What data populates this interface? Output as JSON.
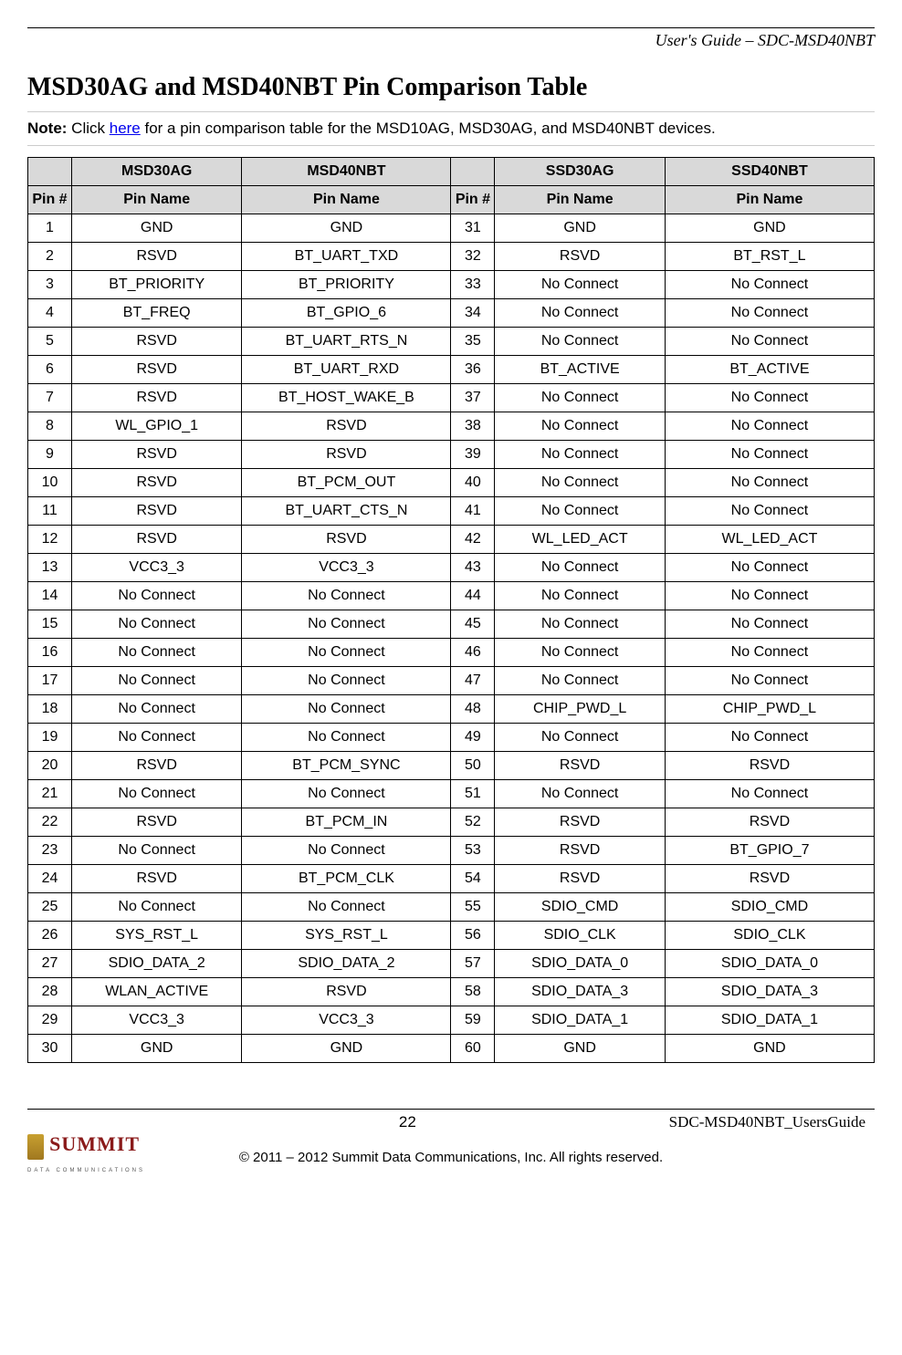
{
  "header": {
    "doc_title": "User's Guide – SDC-MSD40NBT"
  },
  "title": "MSD30AG and MSD40NBT Pin Comparison Table",
  "note": {
    "prefix": "Note:",
    "before_link": " Click ",
    "link_text": "here",
    "after_link": " for a pin comparison table for the MSD10AG, MSD30AG, and MSD40NBT devices."
  },
  "table": {
    "top_headers": [
      "",
      "MSD30AG",
      "MSD40NBT",
      "",
      "SSD30AG",
      "SSD40NBT"
    ],
    "sub_headers": [
      "Pin #",
      "Pin Name",
      "Pin Name",
      "Pin #",
      "Pin Name",
      "Pin Name"
    ],
    "rows": [
      [
        "1",
        "GND",
        "GND",
        "31",
        "GND",
        "GND"
      ],
      [
        "2",
        "RSVD",
        "BT_UART_TXD",
        "32",
        "RSVD",
        "BT_RST_L"
      ],
      [
        "3",
        "BT_PRIORITY",
        "BT_PRIORITY",
        "33",
        "No Connect",
        "No Connect"
      ],
      [
        "4",
        "BT_FREQ",
        "BT_GPIO_6",
        "34",
        "No Connect",
        "No Connect"
      ],
      [
        "5",
        "RSVD",
        "BT_UART_RTS_N",
        "35",
        "No Connect",
        "No Connect"
      ],
      [
        "6",
        "RSVD",
        "BT_UART_RXD",
        "36",
        "BT_ACTIVE",
        "BT_ACTIVE"
      ],
      [
        "7",
        "RSVD",
        "BT_HOST_WAKE_B",
        "37",
        "No Connect",
        "No Connect"
      ],
      [
        "8",
        "WL_GPIO_1",
        "RSVD",
        "38",
        "No Connect",
        "No Connect"
      ],
      [
        "9",
        "RSVD",
        "RSVD",
        "39",
        "No Connect",
        "No Connect"
      ],
      [
        "10",
        "RSVD",
        "BT_PCM_OUT",
        "40",
        "No Connect",
        "No Connect"
      ],
      [
        "11",
        "RSVD",
        "BT_UART_CTS_N",
        "41",
        "No Connect",
        "No Connect"
      ],
      [
        "12",
        "RSVD",
        "RSVD",
        "42",
        "WL_LED_ACT",
        "WL_LED_ACT"
      ],
      [
        "13",
        "VCC3_3",
        "VCC3_3",
        "43",
        "No Connect",
        "No Connect"
      ],
      [
        "14",
        "No Connect",
        "No Connect",
        "44",
        "No Connect",
        "No Connect"
      ],
      [
        "15",
        "No Connect",
        "No Connect",
        "45",
        "No Connect",
        "No Connect"
      ],
      [
        "16",
        "No Connect",
        "No Connect",
        "46",
        "No Connect",
        "No Connect"
      ],
      [
        "17",
        "No Connect",
        "No Connect",
        "47",
        "No Connect",
        "No Connect"
      ],
      [
        "18",
        "No Connect",
        "No Connect",
        "48",
        "CHIP_PWD_L",
        "CHIP_PWD_L"
      ],
      [
        "19",
        "No Connect",
        "No Connect",
        "49",
        "No Connect",
        "No Connect"
      ],
      [
        "20",
        "RSVD",
        "BT_PCM_SYNC",
        "50",
        "RSVD",
        "RSVD"
      ],
      [
        "21",
        "No Connect",
        "No Connect",
        "51",
        "No Connect",
        "No Connect"
      ],
      [
        "22",
        "RSVD",
        "BT_PCM_IN",
        "52",
        "RSVD",
        "RSVD"
      ],
      [
        "23",
        "No Connect",
        "No Connect",
        "53",
        "RSVD",
        "BT_GPIO_7"
      ],
      [
        "24",
        "RSVD",
        "BT_PCM_CLK",
        "54",
        "RSVD",
        "RSVD"
      ],
      [
        "25",
        "No Connect",
        "No Connect",
        "55",
        "SDIO_CMD",
        "SDIO_CMD"
      ],
      [
        "26",
        "SYS_RST_L",
        "SYS_RST_L",
        "56",
        "SDIO_CLK",
        "SDIO_CLK"
      ],
      [
        "27",
        "SDIO_DATA_2",
        "SDIO_DATA_2",
        "57",
        "SDIO_DATA_0",
        "SDIO_DATA_0"
      ],
      [
        "28",
        "WLAN_ACTIVE",
        "RSVD",
        "58",
        "SDIO_DATA_3",
        "SDIO_DATA_3"
      ],
      [
        "29",
        "VCC3_3",
        "VCC3_3",
        "59",
        "SDIO_DATA_1",
        "SDIO_DATA_1"
      ],
      [
        "30",
        "GND",
        "GND",
        "60",
        "GND",
        "GND"
      ]
    ]
  },
  "footer": {
    "page_number": "22",
    "doc_id": "SDC-MSD40NBT_UsersGuide",
    "copyright": "© 2011 – 2012 Summit Data Communications, Inc. All rights reserved.",
    "logo_main": "SUMMIT",
    "logo_sub": "DATA COMMUNICATIONS"
  }
}
